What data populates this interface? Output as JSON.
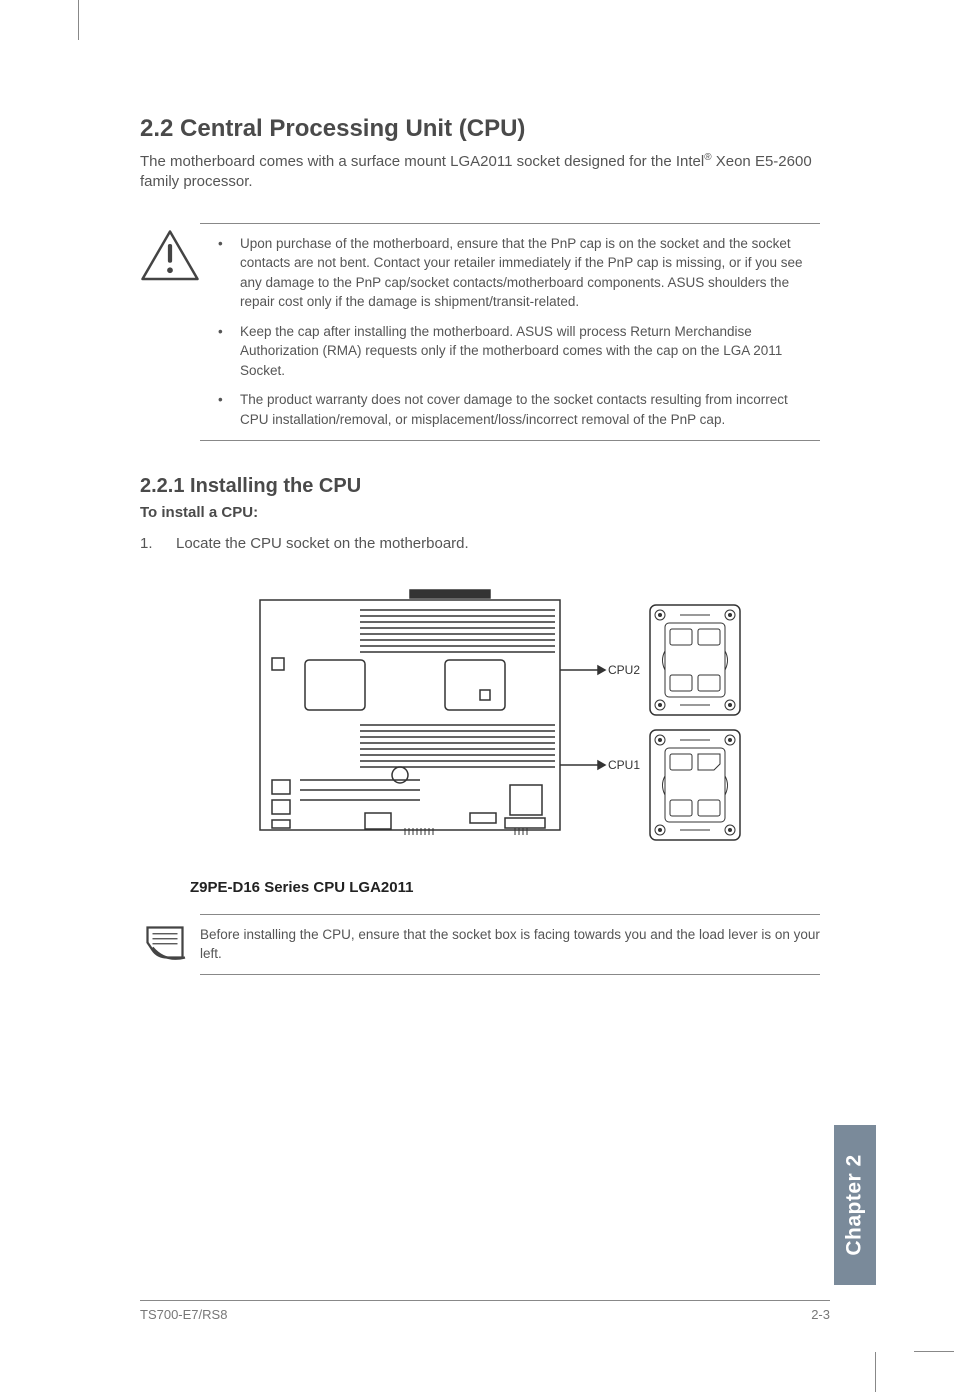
{
  "heading": "2.2       Central Processing Unit (CPU)",
  "intro_pre": "The motherboard comes with a surface mount LGA2011 socket designed for the Intel",
  "intro_sup": "®",
  "intro_post": " Xeon E5-2600 family processor.",
  "warnings": [
    "Upon purchase of the motherboard, ensure that the PnP cap is on the socket and the socket contacts are not bent. Contact your retailer immediately if the PnP cap is missing, or if you see any damage to the PnP cap/socket contacts/motherboard components. ASUS shoulders the repair cost only if the damage is shipment/transit-related.",
    "Keep the cap after installing the motherboard. ASUS will process Return Merchandise Authorization (RMA) requests only if the motherboard comes with the cap on the LGA 2011 Socket.",
    "The product warranty does not cover damage to the socket contacts resulting from incorrect CPU installation/removal, or misplacement/loss/incorrect removal of the PnP cap."
  ],
  "subsection": "2.2.1      Installing the CPU",
  "install_lead": "To install a CPU:",
  "step_num": "1.",
  "step_text": "Locate the CPU socket on the motherboard.",
  "diagram_cpu2": "CPU2",
  "diagram_cpu1": "CPU1",
  "diagram_title": "Z9PE-D16 Series CPU LGA2011",
  "note_text": "Before installing the CPU, ensure that the socket box is facing towards you and the load lever is on your left.",
  "side_tab": "Chapter 2",
  "footer_left": "TS700-E7/RS8",
  "footer_right": "2-3"
}
